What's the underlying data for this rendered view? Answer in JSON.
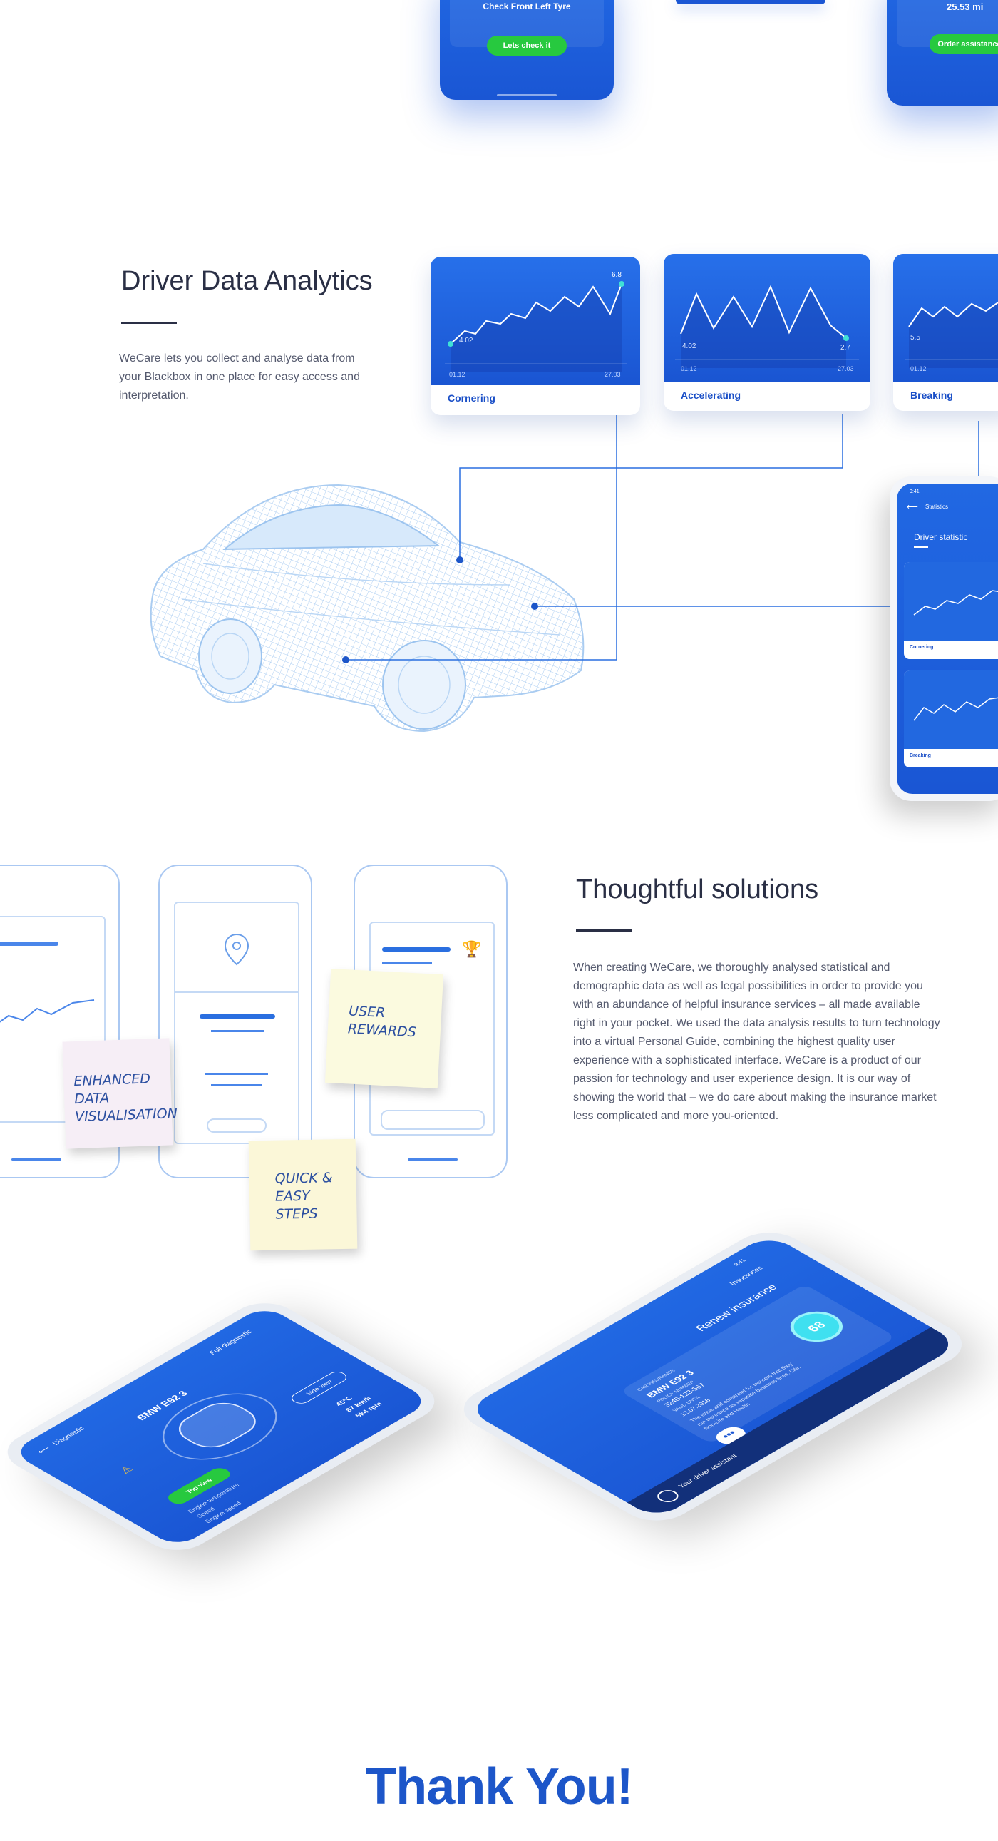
{
  "top": {
    "check_label": "Check Front Left Tyre",
    "check_button": "Lets check it",
    "order_value": "25.53 mi",
    "order_button": "Order assistance"
  },
  "analytics": {
    "title": "Driver Data Analytics",
    "description": "WeCare lets you collect and analyse data from your Blackbox in one place for easy access and interpretation.",
    "cards": [
      {
        "label": "Cornering",
        "start_value": "4.02",
        "end_value": "6.8",
        "date_start": "01.12",
        "date_end": "27.03"
      },
      {
        "label": "Accelerating",
        "start_value": "4.02",
        "end_value": "2.7",
        "date_start": "01.12",
        "date_end": "27.03"
      },
      {
        "label": "Breaking",
        "start_value": "5.5",
        "date_start": "01.12"
      }
    ],
    "phone": {
      "time": "9:41",
      "nav_title": "Statistics",
      "heading": "Driver statistic",
      "card1_label": "Cornering",
      "card2_label": "Breaking"
    }
  },
  "solutions": {
    "title": "Thoughtful solutions",
    "description": "When creating WeCare, we thoroughly analysed statistical and demographic data as well as legal possibilities in order to provide you with an abundance of helpful insurance services – all made available right in your pocket. We used the data analysis results to turn technology into a virtual Personal Guide, combining the highest quality user experience with a sophisticated interface. WeCare is a product of our passion for technology and user experience design. It is our way of showing the world that – we do care about making the insurance market less complicated and more you-oriented.",
    "notes": [
      "ENHANCED DATA VISUALISATION",
      "USER REWARDS",
      "QUICK & EASY STEPS"
    ]
  },
  "phone_left": {
    "nav_back": "Diagnostic",
    "nav_action": "Full diagnostic",
    "car_name": "BMW E92 3",
    "top_view": "Top view",
    "side_view": "Side view",
    "stats": [
      {
        "label": "Engine temperature",
        "value": "45°C"
      },
      {
        "label": "Speed",
        "value": "87 km/h"
      },
      {
        "label": "Engine speed",
        "value": "5k4 rpm"
      }
    ]
  },
  "phone_right": {
    "time": "9:41",
    "nav_title": "Insurances",
    "heading": "Renew insurance",
    "tag": "CAR INSURANCE",
    "car_name": "BMW E92 3",
    "policy_label": "POLICY NUMBER",
    "policy_number": "3240-123-567",
    "valid_label": "VALID UNTIL",
    "valid_date": "12.07.2018",
    "text": "The issue and constraint for insurers that they run insurance as separate business lines. Life, Non-Life and Health.",
    "score": "68",
    "assistant": "Your driver assistant"
  },
  "footer": {
    "thanks": "Thank You!"
  }
}
